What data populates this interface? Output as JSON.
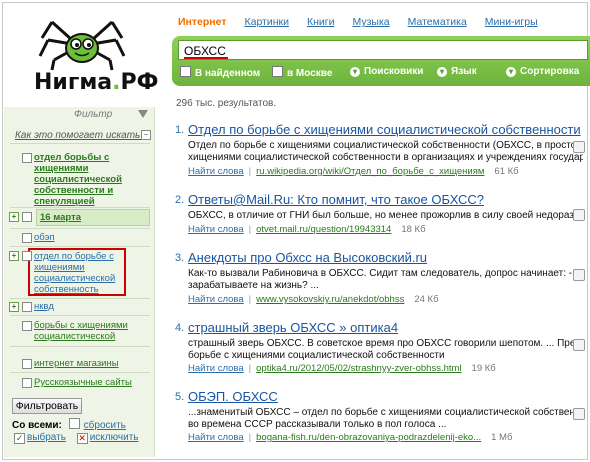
{
  "logo": {
    "text_main": "Нигма",
    "text_dot": ".",
    "text_rf": "РФ"
  },
  "topnav": [
    "Интернет",
    "Картинки",
    "Книги",
    "Музыка",
    "Математика",
    "Мини-игры"
  ],
  "search": {
    "query": "ОБХСС",
    "options": [
      {
        "label": "В найденном",
        "kind": "checkbox"
      },
      {
        "label": "в Москве",
        "kind": "checkbox"
      },
      {
        "label": "Поисковики",
        "kind": "dropdown"
      },
      {
        "label": "Язык",
        "kind": "dropdown"
      },
      {
        "label": "Сортировка",
        "kind": "dropdown"
      }
    ]
  },
  "sidebar": {
    "title": "Фильтр",
    "help": "Как это помогает искать?",
    "items": [
      {
        "label_lines": [
          "отдел борьбы с",
          "хищениями",
          "социалистической",
          "собственности и",
          "спекуляцией"
        ]
      },
      {
        "label_lines": [
          "16 марта"
        ]
      },
      {
        "label_lines": [
          "обэп"
        ]
      },
      {
        "label_lines": [
          "отдел по борьбе с",
          "хищениями",
          "социалистической",
          "собственность"
        ]
      },
      {
        "label_lines": [
          "нквд"
        ]
      },
      {
        "label_lines": [
          "борьбы с хищениями",
          "социалистической"
        ]
      },
      {
        "label_lines": [
          "интернет магазины"
        ]
      },
      {
        "label_lines": [
          "Русскоязычные сайты"
        ]
      }
    ],
    "filter_button": "Фильтровать",
    "select_all_label": "Со всеми:",
    "reset": "сбросить",
    "choose": "выбрать",
    "exclude": "исключить"
  },
  "results_count": "296 тыс. результатов.",
  "results": [
    {
      "num": "1.",
      "title": "Отдел по борьбе с хищениями социалистической собственности",
      "snippet": [
        "Отдел по борьбе с хищениями социалистической собственности (ОБХСС, в просторечи",
        "хищениями социалистической собственности в организациях и учреждениях государсте"
      ],
      "find_words": "Найти слова",
      "url": "ru.wikipedia.org/wiki/Отдел_по_борьбе_с_хищениям",
      "size": "61 Кб"
    },
    {
      "num": "2.",
      "title": "Ответы@Mail.Ru: Кто помнит, что такое ОБХСС?",
      "snippet": [
        "ОБХСС, в отличие от ГНИ был больше, но менее прожорлив в силу своей недоразвито"
      ],
      "find_words": "Найти слова",
      "url": "otvet.mail.ru/question/19943314",
      "size": "18 Кб"
    },
    {
      "num": "3.",
      "title": "Анекдоты про Обхсс на Высоковский.ru",
      "snippet": [
        "Как-то вызвали Рабиновича в ОБХСС. Сидит там следователь, допрос начинает: - Ска",
        "зарабатываете на жизнь? ..."
      ],
      "find_words": "Найти слова",
      "url": "www.vysokovskiy.ru/anekdot/obhss",
      "size": "24 Кб"
    },
    {
      "num": "4.",
      "title": "страшный зверь ОБХСС » оптика4",
      "snippet": [
        "страшный зверь ОБХСС. В советское время про ОБХСС говорили шепотом. ... Престу",
        "борьбе с хищениями социалистической собственности"
      ],
      "find_words": "Найти слова",
      "url": "optika4.ru/2012/05/02/strashnyy-zver-obhss.html",
      "size": "19 Кб"
    },
    {
      "num": "5.",
      "title": "ОБЭП. ОБХСС",
      "snippet": [
        "...знаменитый ОБХСС – отдел по борьбе с хищениями социалистической собственност",
        "во времена СССР рассказывали только в пол голоса ..."
      ],
      "find_words": "Найти слова",
      "url": "bogana-fish.ru/den-obrazovaniya-podrazdelenij-eko...",
      "size": "1 Мб"
    }
  ]
}
